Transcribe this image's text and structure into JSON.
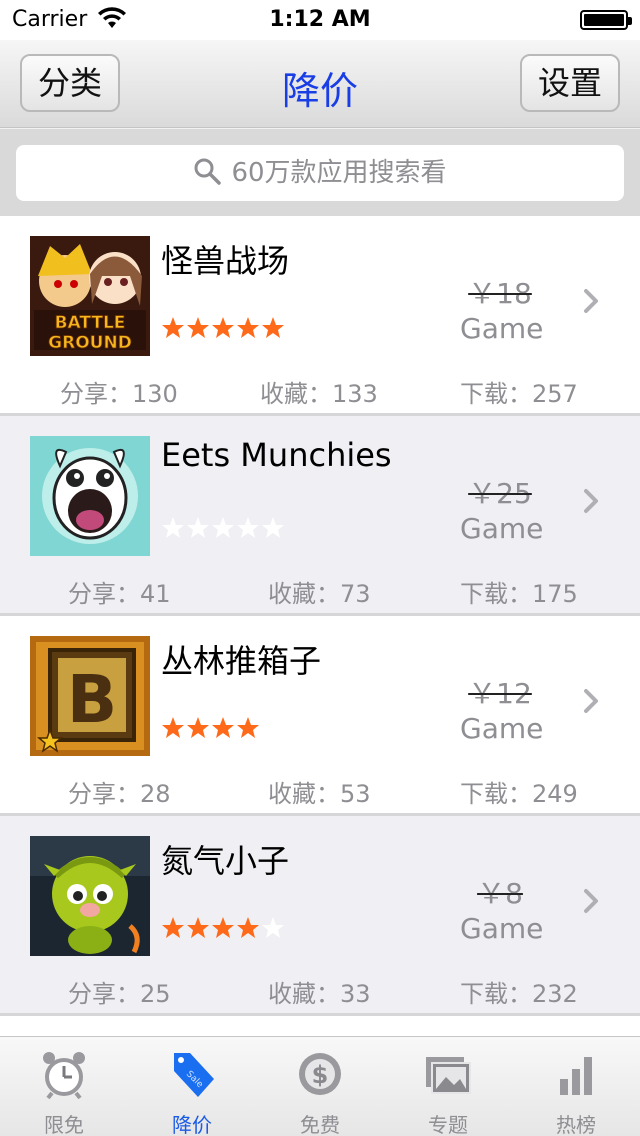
{
  "status_bar": {
    "carrier": "Carrier",
    "time": "1:12 AM"
  },
  "nav": {
    "left_button": "分类",
    "title": "降价",
    "right_button": "设置"
  },
  "search": {
    "placeholder": "60万款应用搜索看"
  },
  "apps": [
    {
      "name": "怪兽战场",
      "rating": 5,
      "price": "￥18",
      "category": "Game",
      "share_label": "分享：130",
      "fav_label": "收藏：133",
      "download_label": "下载：257",
      "icon": "battle-ground-icon"
    },
    {
      "name": "Eets Munchies",
      "rating": 0,
      "price": "￥25",
      "category": "Game",
      "share_label": "分享：41",
      "fav_label": "收藏：73",
      "download_label": "下载：175",
      "icon": "eets-munchies-icon"
    },
    {
      "name": "丛林推箱子",
      "rating": 4.5,
      "price": "￥12",
      "category": "Game",
      "share_label": "分享：28",
      "fav_label": "收藏：53",
      "download_label": "下载：249",
      "icon": "jungle-box-icon"
    },
    {
      "name": "氮气小子",
      "rating": 4,
      "price": "￥8",
      "category": "Game",
      "share_label": "分享：25",
      "fav_label": "收藏：33",
      "download_label": "下载：232",
      "icon": "nitro-kid-icon"
    }
  ],
  "tabs": [
    {
      "label": "限免",
      "icon": "alarm-clock-icon",
      "active": false
    },
    {
      "label": "降价",
      "icon": "sale-tag-icon",
      "active": true
    },
    {
      "label": "免费",
      "icon": "dollar-coin-icon",
      "active": false
    },
    {
      "label": "专题",
      "icon": "photo-stack-icon",
      "active": false
    },
    {
      "label": "热榜",
      "icon": "bar-chart-icon",
      "active": false
    }
  ],
  "colors": {
    "accent": "#1a3ee6",
    "star": "#ff6a1a",
    "tab_active": "#1a5be6"
  }
}
